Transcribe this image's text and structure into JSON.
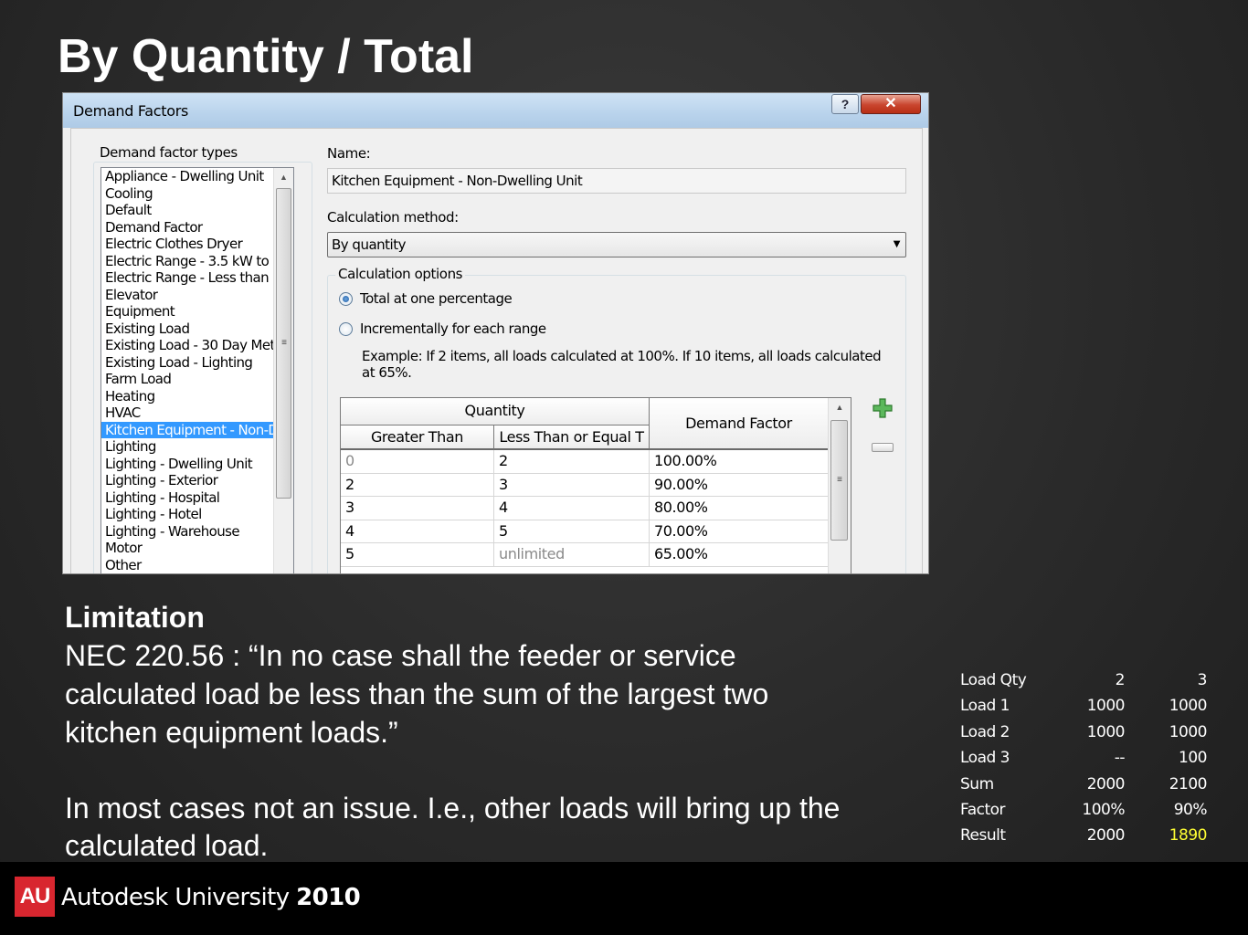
{
  "slide": {
    "title": "By Quantity / Total",
    "limitation_title": "Limitation",
    "paragraph1": [
      "NEC 220.56 : “In no case shall the feeder or service",
      "calculated load be less than the sum of the largest two",
      "kitchen equipment loads.”"
    ],
    "paragraph2": [
      "In most cases not an issue.  I.e., other loads will bring up the",
      "calculated load."
    ]
  },
  "dialog": {
    "title": "Demand Factors",
    "help_label": "?",
    "close_label": "✕",
    "types_group_label": "Demand factor types",
    "types": [
      "Appliance - Dwelling Unit",
      "Cooling",
      "Default",
      "Demand Factor",
      "Electric Clothes Dryer",
      "Electric Range - 3.5 kW to",
      "Electric Range - Less than",
      "Elevator",
      "Equipment",
      "Existing Load",
      "Existing Load - 30 Day Met",
      "Existing Load - Lighting",
      "Farm Load",
      "Heating",
      "HVAC",
      "Kitchen Equipment - Non-D",
      "Lighting",
      "Lighting - Dwelling Unit",
      "Lighting - Exterior",
      "Lighting - Hospital",
      "Lighting - Hotel",
      "Lighting - Warehouse",
      "Motor",
      "Other"
    ],
    "selected_type": "Kitchen Equipment - Non-D",
    "name_label": "Name:",
    "name_value": "Kitchen Equipment - Non-Dwelling Unit",
    "method_label": "Calculation method:",
    "method_value": "By quantity",
    "options_group_label": "Calculation options",
    "option_total": "Total at one percentage",
    "option_incremental": "Incrementally for each range",
    "selected_option": "total",
    "example_text": [
      "Example: If 2 items, all loads calculated at 100%. If 10 items, all loads calculated",
      "at 65%."
    ],
    "grid": {
      "group_header": "Quantity",
      "col_greater": "Greater Than",
      "col_less": "Less Than or Equal T",
      "col_factor": "Demand Factor",
      "rows": [
        {
          "greater": "0",
          "less": "2",
          "factor": "100.00%"
        },
        {
          "greater": "2",
          "less": "3",
          "factor": "90.00%"
        },
        {
          "greater": "3",
          "less": "4",
          "factor": "80.00%"
        },
        {
          "greater": "4",
          "less": "5",
          "factor": "70.00%"
        },
        {
          "greater": "5",
          "less": "unlimited",
          "factor": "65.00%"
        }
      ]
    }
  },
  "calc_table": [
    {
      "label": "Load Qty",
      "a": "2",
      "b": "3"
    },
    {
      "label": "Load 1",
      "a": "1000",
      "b": "1000"
    },
    {
      "label": "Load 2",
      "a": "1000",
      "b": "1000"
    },
    {
      "label": "Load 3",
      "a": "--",
      "b": "100"
    },
    {
      "label": "Sum",
      "a": "2000",
      "b": "2100"
    },
    {
      "label": "Factor",
      "a": "100%",
      "b": "90%"
    },
    {
      "label": "Result",
      "a": "2000",
      "b": "1890"
    }
  ],
  "footer": {
    "logo_text": "AU",
    "brand_name": "Autodesk University",
    "brand_year": "2010"
  },
  "colors": {
    "highlight": "#ffff33",
    "selection": "#3399ff",
    "logo_red": "#d8262f"
  }
}
